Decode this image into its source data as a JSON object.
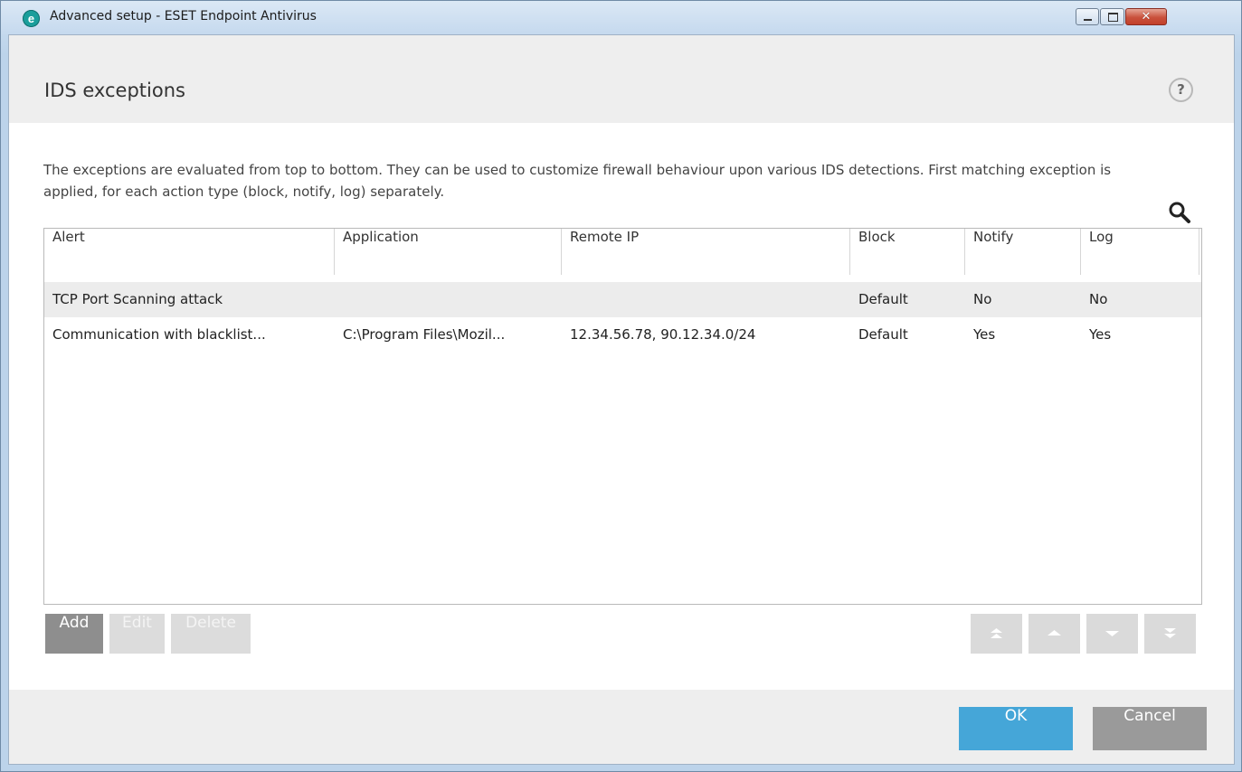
{
  "window": {
    "app_icon": "e",
    "title": "Advanced setup - ESET Endpoint Antivirus",
    "close_glyph": "✕"
  },
  "header": {
    "title": "IDS exceptions",
    "help_label": "?"
  },
  "description": "The exceptions are evaluated from top to bottom. They can be used to customize firewall behaviour upon various IDS detections. First matching exception is applied, for each action type (block, notify, log) separately.",
  "table": {
    "columns": [
      "Alert",
      "Application",
      "Remote IP",
      "Block",
      "Notify",
      "Log"
    ],
    "rows": [
      {
        "alert": "TCP Port Scanning attack",
        "application": "",
        "remote_ip": "",
        "block": "Default",
        "notify": "No",
        "log": "No"
      },
      {
        "alert": "Communication with blacklist...",
        "application": "C:\\Program Files\\Mozil...",
        "remote_ip": "12.34.56.78, 90.12.34.0/24",
        "block": "Default",
        "notify": "Yes",
        "log": "Yes"
      }
    ]
  },
  "list_buttons": {
    "add": "Add",
    "edit": "Edit",
    "delete": "Delete"
  },
  "move_buttons": [
    "move-top-icon",
    "move-up-icon",
    "move-down-icon",
    "move-bottom-icon"
  ],
  "footer": {
    "ok": "OK",
    "cancel": "Cancel"
  },
  "colors": {
    "accent": "#45a6d8",
    "brand": "#1a9e9b",
    "selected_row": "#ececec"
  }
}
